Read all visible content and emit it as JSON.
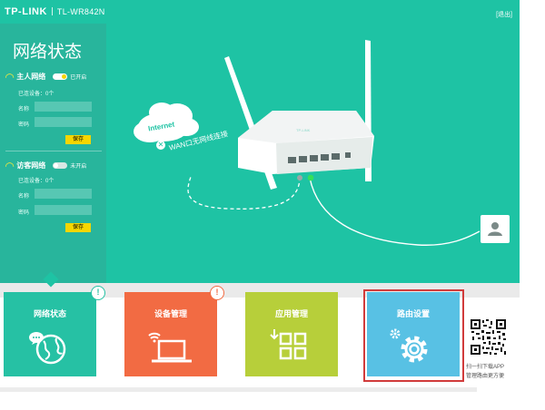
{
  "header": {
    "brand": "TP-LINK",
    "model": "TL-WR842N",
    "logout": "[退出]"
  },
  "panel": {
    "title": "网络状态",
    "host_network": {
      "name": "主人网络",
      "state": "已开启",
      "connected": "已连设备：0个",
      "name_label": "名称",
      "password_label": "密码",
      "name_value": "",
      "password_value": "",
      "save": "保存"
    },
    "guest_network": {
      "name": "访客网络",
      "state": "未开启",
      "connected": "已连设备：0个",
      "name_label": "名称",
      "password_label": "密码",
      "name_value": "",
      "password_value": "",
      "save": "保存"
    }
  },
  "diagram": {
    "cloud_label": "Internet",
    "wan_status": "WAN口无网线连接",
    "router_brand": "TP-LINK"
  },
  "tiles": [
    {
      "label": "网络状态",
      "color": "#26c1a4",
      "badge": "!"
    },
    {
      "label": "设备管理",
      "color": "#f26b43",
      "badge": "!"
    },
    {
      "label": "应用管理",
      "color": "#b7cf3a"
    },
    {
      "label": "路由设置",
      "color": "#58c1e4"
    }
  ],
  "qr": {
    "line1": "扫一扫下载APP",
    "line2": "管理路由更方便"
  },
  "colors": {
    "stage": "#1ec3a4",
    "panel": "#28b59c",
    "accent_yellow": "#f6d600",
    "selection": "#d13b3b"
  }
}
